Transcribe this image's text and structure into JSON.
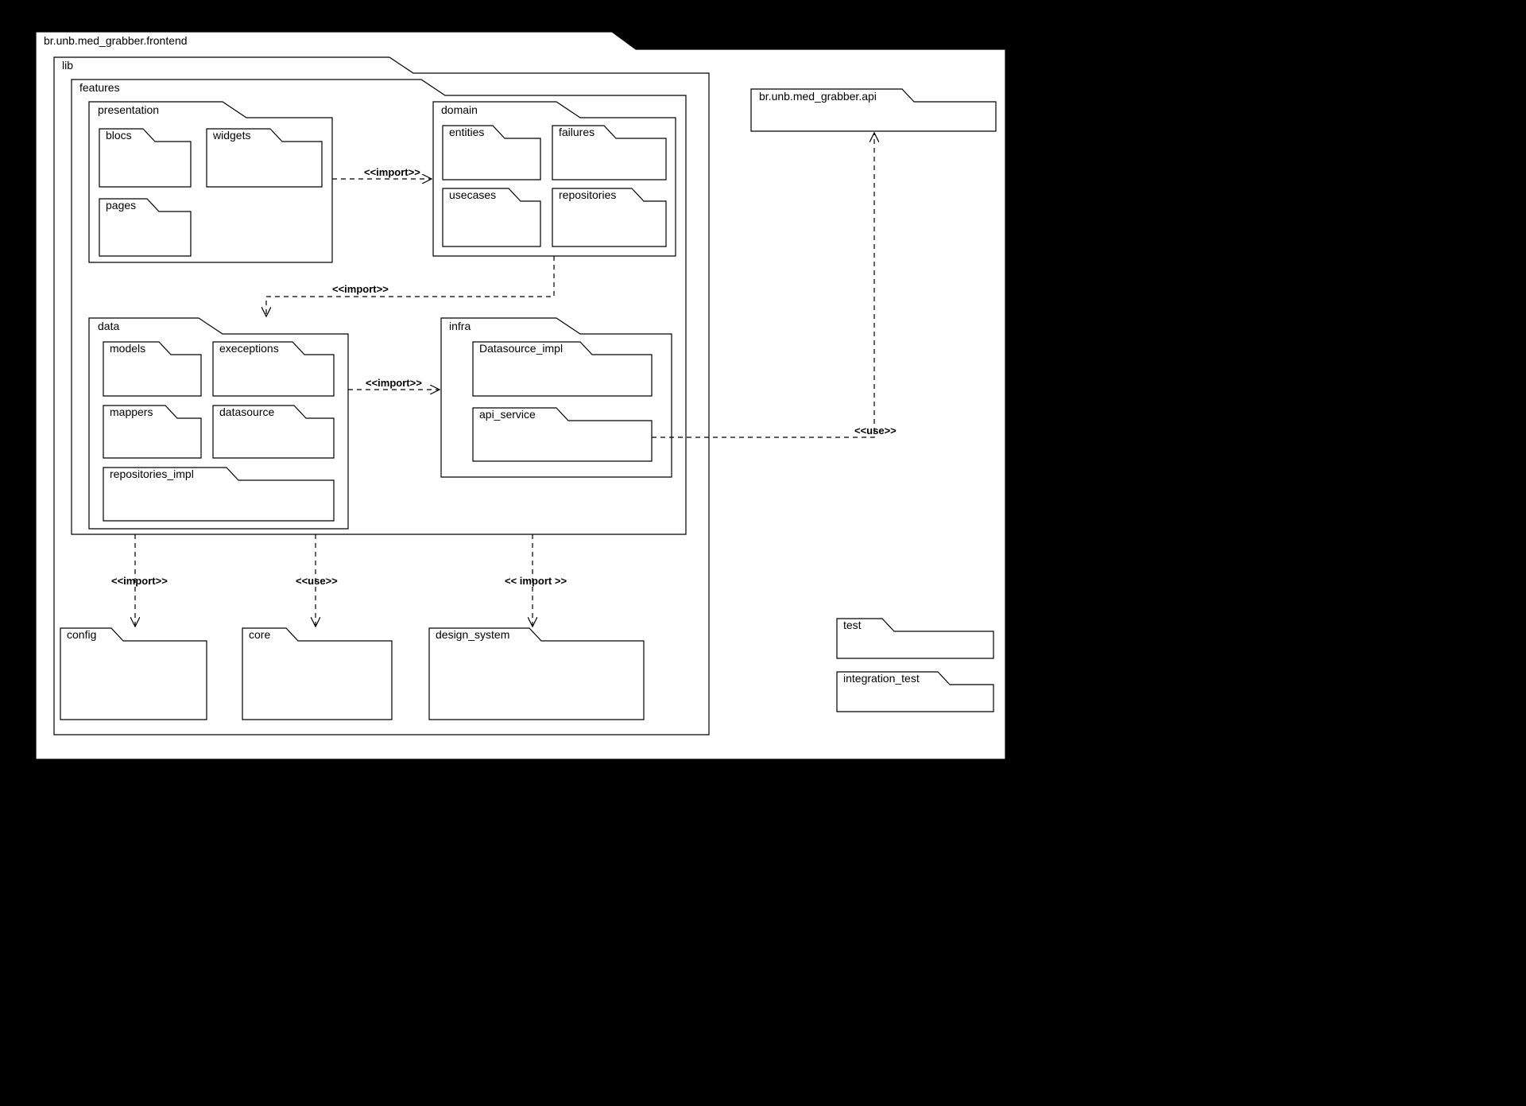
{
  "diagram_type": "UML package diagram",
  "packages": {
    "frontend": "br.unb.med_grabber.frontend",
    "api": "br.unb.med_grabber.api",
    "lib": "lib",
    "features": "features",
    "presentation": "presentation",
    "blocs": "blocs",
    "widgets": "widgets",
    "pages": "pages",
    "domain": "domain",
    "entities": "entities",
    "failures": "failures",
    "usecases": "usecases",
    "repositories": "repositories",
    "data": "data",
    "models": "models",
    "execeptions": "execeptions",
    "mappers": "mappers",
    "datasource": "datasource",
    "repositories_impl": "repositories_impl",
    "infra": "infra",
    "datasource_impl": "Datasource_impl",
    "api_service": "api_service",
    "config": "config",
    "core": "core",
    "design_system": "design_system",
    "test": "test",
    "integration_test": "integration_test"
  },
  "relationships": {
    "import": "<<import>>",
    "use": "<<use>>",
    "import_spaced": "<< import >>"
  },
  "chart_data": {
    "nodes": [
      {
        "id": "frontend",
        "parent": null
      },
      {
        "id": "lib",
        "parent": "frontend"
      },
      {
        "id": "features",
        "parent": "lib"
      },
      {
        "id": "presentation",
        "parent": "features"
      },
      {
        "id": "blocs",
        "parent": "presentation"
      },
      {
        "id": "widgets",
        "parent": "presentation"
      },
      {
        "id": "pages",
        "parent": "presentation"
      },
      {
        "id": "domain",
        "parent": "features"
      },
      {
        "id": "entities",
        "parent": "domain"
      },
      {
        "id": "failures",
        "parent": "domain"
      },
      {
        "id": "usecases",
        "parent": "domain"
      },
      {
        "id": "repositories",
        "parent": "domain"
      },
      {
        "id": "data",
        "parent": "features"
      },
      {
        "id": "models",
        "parent": "data"
      },
      {
        "id": "execeptions",
        "parent": "data"
      },
      {
        "id": "mappers",
        "parent": "data"
      },
      {
        "id": "datasource",
        "parent": "data"
      },
      {
        "id": "repositories_impl",
        "parent": "data"
      },
      {
        "id": "infra",
        "parent": "features"
      },
      {
        "id": "datasource_impl",
        "parent": "infra"
      },
      {
        "id": "api_service",
        "parent": "infra"
      },
      {
        "id": "config",
        "parent": "lib"
      },
      {
        "id": "core",
        "parent": "lib"
      },
      {
        "id": "design_system",
        "parent": "lib"
      },
      {
        "id": "api",
        "parent": null
      },
      {
        "id": "test",
        "parent": null
      },
      {
        "id": "integration_test",
        "parent": null
      }
    ],
    "edges": [
      {
        "from": "presentation",
        "to": "domain",
        "stereotype": "import"
      },
      {
        "from": "domain",
        "to": "data",
        "stereotype": "import"
      },
      {
        "from": "data",
        "to": "infra",
        "stereotype": "import"
      },
      {
        "from": "features",
        "to": "config",
        "stereotype": "import"
      },
      {
        "from": "features",
        "to": "core",
        "stereotype": "use"
      },
      {
        "from": "features",
        "to": "design_system",
        "stereotype": "import"
      },
      {
        "from": "api_service",
        "to": "api",
        "stereotype": "use"
      }
    ]
  }
}
